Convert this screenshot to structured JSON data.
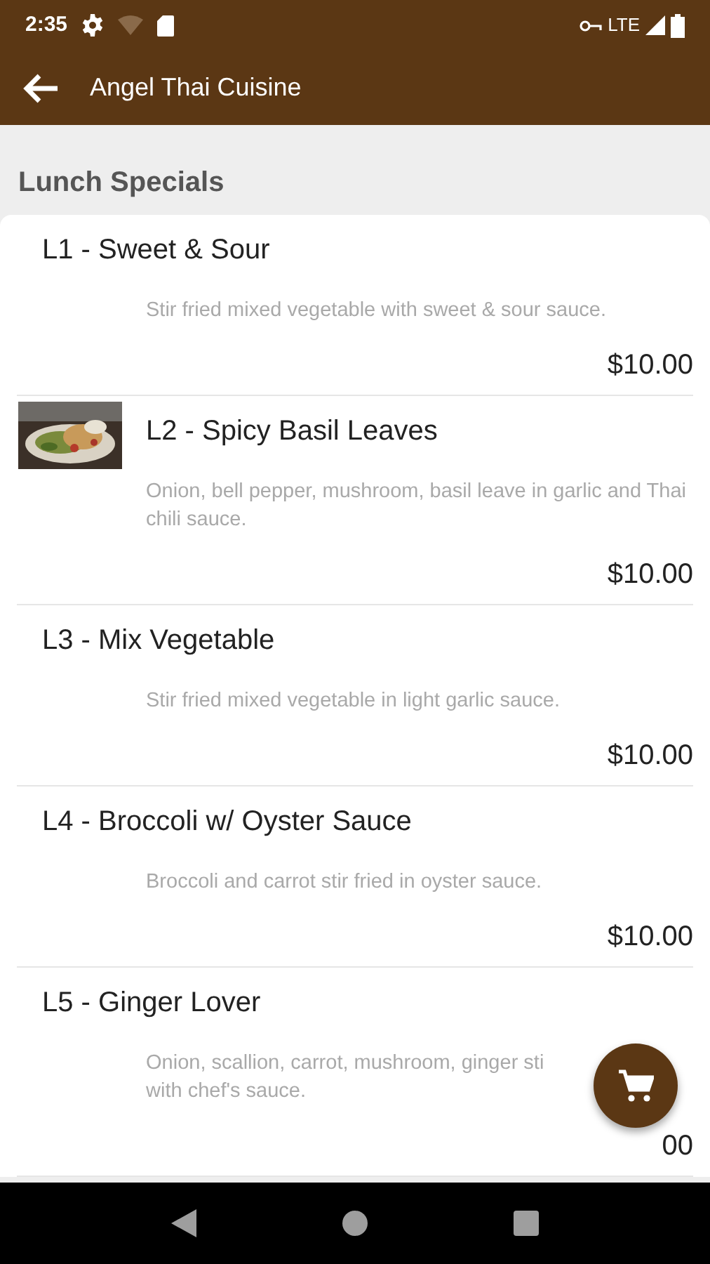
{
  "status_bar": {
    "time": "2:35",
    "network": "LTE"
  },
  "toolbar": {
    "title": "Angel Thai Cuisine"
  },
  "section": {
    "title": "Lunch Specials"
  },
  "items": [
    {
      "title": "L1 - Sweet & Sour",
      "description": "Stir fried mixed vegetable with sweet & sour sauce.",
      "price": "$10.00"
    },
    {
      "title": "L2 - Spicy Basil Leaves",
      "description": "Onion, bell pepper, mushroom, basil leave in garlic and Thai chili sauce.",
      "price": "$10.00"
    },
    {
      "title": "L3 - Mix Vegetable",
      "description": "Stir fried mixed vegetable in light garlic sauce.",
      "price": "$10.00"
    },
    {
      "title": "L4 - Broccoli w/ Oyster Sauce",
      "description": "Broccoli and carrot stir fried in oyster sauce.",
      "price": "$10.00"
    },
    {
      "title": "L5 - Ginger Lover",
      "description": "Onion, scallion, carrot, mushroom, ginger sti",
      "description_2": "with chef's sauce.",
      "price": "00"
    }
  ]
}
